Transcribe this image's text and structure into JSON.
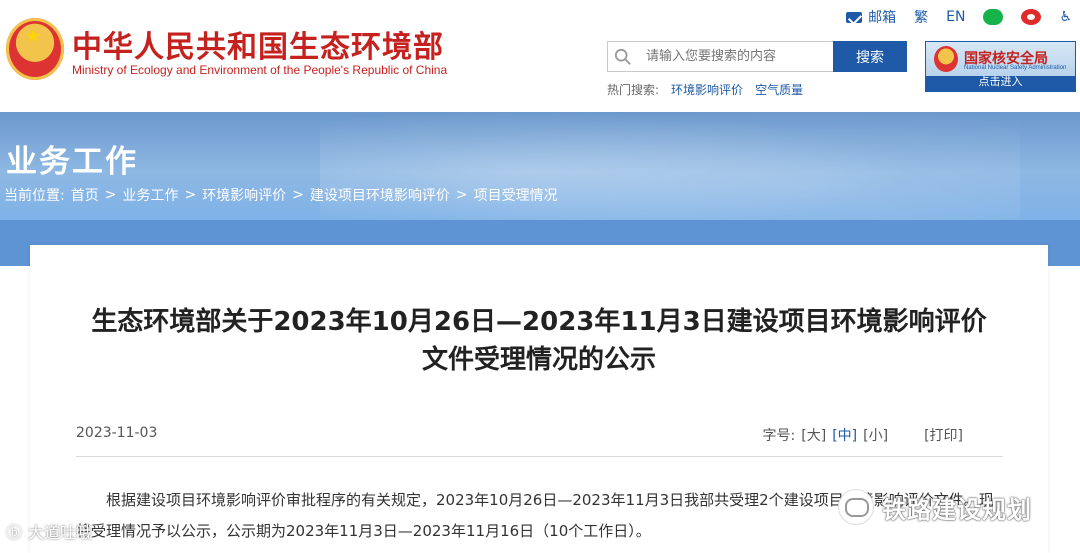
{
  "header": {
    "site_title": "中华人民共和国生态环境部",
    "site_subtitle": "Ministry of Ecology and Environment of the People's Republic of China",
    "top_links": {
      "mail": "邮箱",
      "traditional": "繁",
      "english": "EN"
    },
    "search": {
      "placeholder": "请输入您要搜索的内容",
      "button": "搜索"
    },
    "hot_search": {
      "label": "热门搜索:",
      "items": [
        "环境影响评价",
        "空气质量"
      ]
    },
    "nnsa": {
      "title": "国家核安全局",
      "subtitle": "National Nuclear Safety Administration",
      "enter": "点击进入"
    }
  },
  "section": {
    "title": "业务工作",
    "breadcrumb": {
      "label": "当前位置:",
      "items": [
        "首页",
        "业务工作",
        "环境影响评价",
        "建设项目环境影响评价",
        "项目受理情况"
      ]
    }
  },
  "article": {
    "title_line1": "生态环境部关于2023年10月26日—2023年11月3日建设项目环境影响评价",
    "title_line2": "文件受理情况的公示",
    "date": "2023-11-03",
    "font_size_label": "字号:",
    "font_sizes": [
      "[大]",
      "[中]",
      "[小]"
    ],
    "print": "[打印]",
    "body": "根据建设项目环境影响评价审批程序的有关规定，2023年10月26日—2023年11月3日我部共受理2个建设项目环境影响评价文件。现将受理情况予以公示，公示期为2023年11月3日—2023年11月16日（10个工作日）。"
  },
  "watermark": {
    "wechat": "铁路建设规划",
    "bottom_left": "大道吐哦"
  },
  "colors": {
    "brand_red": "#c5221f",
    "brand_blue": "#1e5aa8",
    "banner_blue": "#5e93d4"
  }
}
